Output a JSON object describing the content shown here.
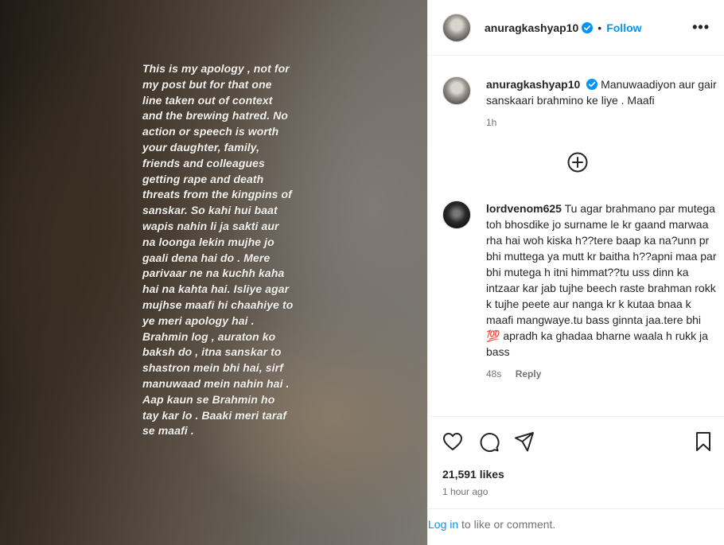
{
  "media": {
    "story_text": "This is my apology , not for my post but for that one line taken out of context and the brewing hatred. No action or speech is worth your daughter, family, friends and colleagues getting rape and death threats from the kingpins of sanskar. So kahi hui baat wapis nahin li ja sakti aur na loonga lekin mujhe jo gaali dena hai do . Mere parivaar ne na kuchh kaha hai na kahta hai. Isliye agar mujhse maafi hi chaahiye to ye meri apology hai . Brahmin log , auraton ko baksh do , itna sanskar to shastron mein bhi hai, sirf manuwaad mein nahin hai . Aap kaun se Brahmin ho tay kar lo . Baaki meri taraf se maafi ."
  },
  "header": {
    "username": "anuragkashyap10",
    "separator": "•",
    "follow_label": "Follow",
    "more_label": "•••"
  },
  "caption": {
    "username": "anuragkashyap10",
    "text": "Manuwaadiyon aur gair sanskaari brahmino ke liye . Maafi",
    "time": "1h"
  },
  "comment": {
    "username": "lordvenom625",
    "text": "Tu agar brahmano par mutega toh bhosdike jo surname le kr gaand marwaa rha hai woh kiska h??tere baap ka na?unn pr bhi muttega ya mutt kr baitha h??apni maa par bhi mutega h itni himmat??tu uss dinn ka intzaar kar jab tujhe beech raste brahman rokk k tujhe peete aur nanga kr k kutaa bnaa k maafi mangwaye.tu bass ginnta jaa.tere bhi",
    "emoji": "💯",
    "text_end": "apradh ka ghadaa bharne waala h rukk ja bass",
    "time": "48s",
    "reply_label": "Reply"
  },
  "actions": {
    "likes": "21,591 likes",
    "time_ago": "1 hour ago"
  },
  "login_bar": {
    "link": "Log in",
    "rest": "to like or comment."
  },
  "colors": {
    "accent": "#0095f6",
    "secondary_text": "#737373",
    "divider": "#efefef"
  }
}
